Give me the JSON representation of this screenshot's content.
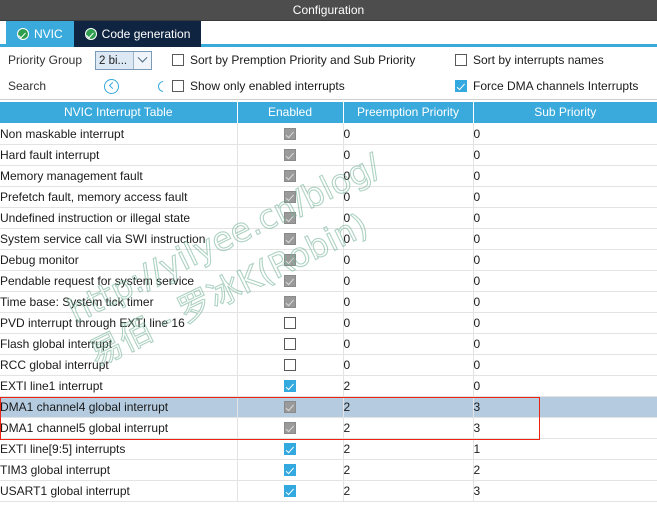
{
  "window": {
    "title": "Configuration"
  },
  "tabs": [
    {
      "label": "NVIC",
      "icon": "check-circle-icon",
      "active": true
    },
    {
      "label": "Code generation",
      "icon": "check-circle-icon",
      "active": false
    }
  ],
  "options": {
    "priority_group_label": "Priority Group",
    "priority_group_value": "2 bi...",
    "search_label": "Search",
    "prev_icon": "circle-back-icon",
    "next_icon": "circle-forward-icon",
    "checkboxes": [
      {
        "label": "Sort by Premption Priority and Sub Priority",
        "checked": false
      },
      {
        "label": "Sort by interrupts names",
        "checked": false
      },
      {
        "label": "Show only enabled interrupts",
        "checked": false
      },
      {
        "label": "Force DMA channels Interrupts",
        "checked": true
      }
    ]
  },
  "table": {
    "columns": [
      "NVIC Interrupt Table",
      "Enabled",
      "Preemption Priority",
      "Sub Priority"
    ],
    "rows": [
      {
        "name": "Non maskable interrupt",
        "enabled": true,
        "locked": true,
        "preemption": "0",
        "sub": "0",
        "selected": false
      },
      {
        "name": "Hard fault interrupt",
        "enabled": true,
        "locked": true,
        "preemption": "0",
        "sub": "0",
        "selected": false
      },
      {
        "name": "Memory management fault",
        "enabled": true,
        "locked": true,
        "preemption": "0",
        "sub": "0",
        "selected": false
      },
      {
        "name": "Prefetch fault, memory access fault",
        "enabled": true,
        "locked": true,
        "preemption": "0",
        "sub": "0",
        "selected": false
      },
      {
        "name": "Undefined instruction or illegal state",
        "enabled": true,
        "locked": true,
        "preemption": "0",
        "sub": "0",
        "selected": false
      },
      {
        "name": "System service call via SWI instruction",
        "enabled": true,
        "locked": true,
        "preemption": "0",
        "sub": "0",
        "selected": false
      },
      {
        "name": "Debug monitor",
        "enabled": true,
        "locked": true,
        "preemption": "0",
        "sub": "0",
        "selected": false
      },
      {
        "name": "Pendable request for system service",
        "enabled": true,
        "locked": true,
        "preemption": "0",
        "sub": "0",
        "selected": false
      },
      {
        "name": "Time base: System tick timer",
        "enabled": true,
        "locked": true,
        "preemption": "0",
        "sub": "0",
        "selected": false
      },
      {
        "name": "PVD interrupt through EXTI line 16",
        "enabled": false,
        "locked": false,
        "preemption": "0",
        "sub": "0",
        "selected": false
      },
      {
        "name": "Flash global interrupt",
        "enabled": false,
        "locked": false,
        "preemption": "0",
        "sub": "0",
        "selected": false
      },
      {
        "name": "RCC global interrupt",
        "enabled": false,
        "locked": false,
        "preemption": "0",
        "sub": "0",
        "selected": false
      },
      {
        "name": "EXTI line1 interrupt",
        "enabled": true,
        "locked": false,
        "preemption": "2",
        "sub": "0",
        "selected": false
      },
      {
        "name": "DMA1 channel4 global interrupt",
        "enabled": true,
        "locked": true,
        "preemption": "2",
        "sub": "3",
        "selected": true
      },
      {
        "name": "DMA1 channel5 global interrupt",
        "enabled": true,
        "locked": true,
        "preemption": "2",
        "sub": "3",
        "selected": false
      },
      {
        "name": "EXTI line[9:5] interrupts",
        "enabled": true,
        "locked": false,
        "preemption": "2",
        "sub": "1",
        "selected": false
      },
      {
        "name": "TIM3 global interrupt",
        "enabled": true,
        "locked": false,
        "preemption": "2",
        "sub": "2",
        "selected": false
      },
      {
        "name": "USART1 global interrupt",
        "enabled": true,
        "locked": false,
        "preemption": "2",
        "sub": "3",
        "selected": false
      }
    ]
  },
  "annotation": {
    "color": "#ee2211",
    "highlights_rows": [
      13,
      14
    ]
  },
  "watermark": {
    "line1": "http://yilyee.cn/blog/",
    "line2": "易佰 - 罗冰K(Robin)"
  }
}
